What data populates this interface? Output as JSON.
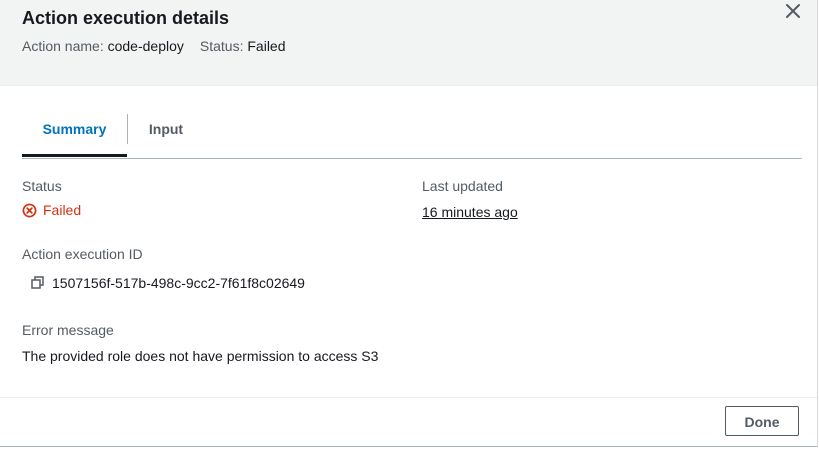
{
  "modal": {
    "title": "Action execution details",
    "action_name_label": "Action name:",
    "action_name_value": "code-deploy",
    "status_label": "Status:",
    "status_value": "Failed"
  },
  "tabs": [
    {
      "label": "Summary",
      "active": true
    },
    {
      "label": "Input",
      "active": false
    }
  ],
  "summary": {
    "status_label": "Status",
    "status_value": "Failed",
    "last_updated_label": "Last updated",
    "last_updated_value": "16 minutes ago",
    "execution_id_label": "Action execution ID",
    "execution_id_value": "1507156f-517b-498c-9cc2-7f61f8c02649",
    "error_label": "Error message",
    "error_value": "The provided role does not have permission to access S3"
  },
  "footer": {
    "done_label": "Done"
  },
  "colors": {
    "header_bg": "#f2f3f3",
    "active_tab": "#0073bb",
    "error": "#d13212"
  },
  "icons": {
    "close": "close-icon",
    "status": "error-circle-icon",
    "copy": "copy-icon"
  }
}
